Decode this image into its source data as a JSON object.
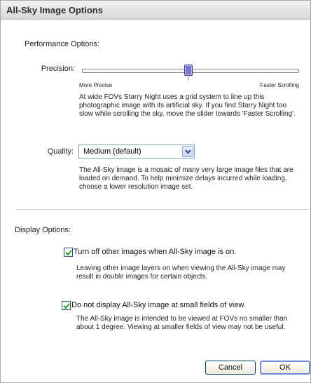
{
  "window": {
    "title": "All-Sky Image Options"
  },
  "performance": {
    "heading": "Performance Options:",
    "precision_label": "Precision:",
    "slider": {
      "left_label": "More Precise",
      "right_label": "Faster Scrolling",
      "value": 0.5
    },
    "precision_description": "At wide FOVs Starry Night uses a grid system to line up this photographic image with its artificial sky. If you find Starry Night too slow while scrolling the sky, move the slider towards 'Faster Scrolling'.",
    "quality_label": "Quality:",
    "quality_value": "Medium (default)",
    "quality_description": "The All-Sky image is a mosaic of many very large image files that are loaded on demand. To help minimize delays incurred while loading, choose a lower resolution image set."
  },
  "display": {
    "heading": "Display Options:",
    "option1": {
      "checked": true,
      "label": "Turn off other images when All-Sky image is on.",
      "description": "Leaving other image layers on when viewing the All-Sky image may result in double images for certain objects."
    },
    "option2": {
      "checked": true,
      "label": "Do not display All-Sky image at small fields of view.",
      "description": "The All-Sky image is intended to be viewed at FOVs no smaller than about 1 degree. Viewing at smaller fields of view may not be useful."
    }
  },
  "buttons": {
    "cancel": "Cancel",
    "ok": "OK"
  },
  "colors": {
    "title_bar": "#dcdcdc",
    "slider_thumb": "#7a7acb",
    "checkbox_check": "#20a020"
  }
}
